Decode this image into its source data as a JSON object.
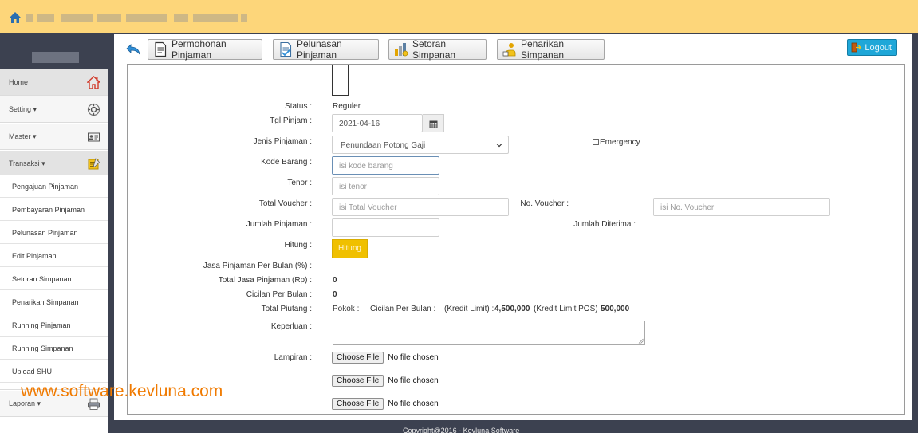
{
  "toolbar": {
    "buttons": [
      {
        "label": "Permohonan Pinjaman",
        "icon": "document-icon"
      },
      {
        "label": "Pelunasan Pinjaman",
        "icon": "document-check-icon"
      },
      {
        "label": "Setoran Simpanan",
        "icon": "deposit-icon"
      },
      {
        "label": "Penarikan Simpanan",
        "icon": "withdraw-icon"
      }
    ],
    "logout_label": "Logout"
  },
  "sidebar": {
    "items": [
      {
        "label": "Home",
        "icon": "house-icon"
      },
      {
        "label": "Setting ▾",
        "icon": "gear-icon"
      },
      {
        "label": "Master ▾",
        "icon": "id-card-icon"
      },
      {
        "label": "Transaksi ▾",
        "icon": "notepad-icon"
      }
    ],
    "subitems": [
      "Pengajuan Pinjaman",
      "Pembayaran Pinjaman",
      "Pelunasan Pinjaman",
      "Edit Pinjaman",
      "Setoran Simpanan",
      "Penarikan Simpanan",
      "Running Pinjaman",
      "Running Simpanan",
      "Upload SHU"
    ],
    "laporan": {
      "label": "Laporan ▾",
      "icon": "printer-icon"
    }
  },
  "form": {
    "status": {
      "label": "Status :",
      "value": "Reguler"
    },
    "tgl_pinjam": {
      "label": "Tgl Pinjam :",
      "value": "2021-04-16"
    },
    "jenis_pinjaman": {
      "label": "Jenis Pinjaman :",
      "value": "Penundaan Potong Gaji"
    },
    "emergency_label": "Emergency",
    "kode_barang": {
      "label": "Kode Barang :",
      "placeholder": "isi kode barang"
    },
    "tenor": {
      "label": "Tenor :",
      "placeholder": "isi tenor"
    },
    "total_voucher": {
      "label": "Total Voucher :",
      "placeholder": "isi Total Voucher"
    },
    "no_voucher": {
      "label": "No. Voucher :",
      "placeholder": "isi No. Voucher"
    },
    "jumlah_pinjaman": {
      "label": "Jumlah Pinjaman :"
    },
    "jumlah_diterima": {
      "label": "Jumlah Diterima :"
    },
    "hitung": {
      "label": "Hitung :",
      "button": "Hitung"
    },
    "jasa_per_bulan": {
      "label": "Jasa Pinjaman Per Bulan (%) :"
    },
    "total_jasa": {
      "label": "Total Jasa Pinjaman (Rp) :",
      "value": "0"
    },
    "cicilan": {
      "label": "Cicilan Per Bulan :",
      "value": "0"
    },
    "total_piutang": {
      "label": "Total Piutang :",
      "pokok": "Pokok :",
      "cicilan": "Cicilan Per Bulan :",
      "kredit_limit_label": "(Kredit Limit) :",
      "kredit_limit_value": "4,500,000",
      "kredit_limit_pos_label": "(Kredit Limit POS) :",
      "kredit_limit_pos_value": "500,000"
    },
    "keperluan": {
      "label": "Keperluan :"
    },
    "lampiran": {
      "label": "Lampiran :",
      "button": "Choose File",
      "status": "No file chosen"
    }
  },
  "watermark": "www.software.kevluna.com",
  "footer": "Copyright@2016 - Kevluna Software"
}
